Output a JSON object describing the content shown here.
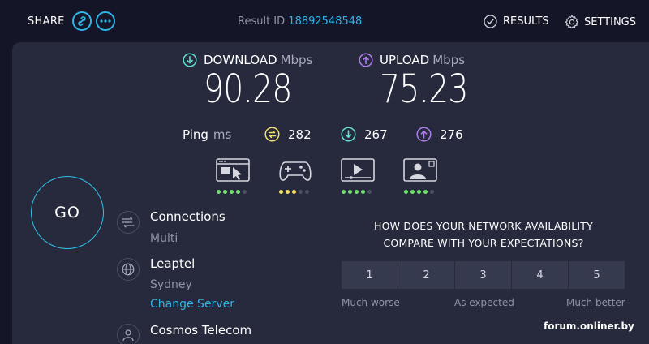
{
  "header": {
    "share_label": "SHARE",
    "result_id_label": "Result ID",
    "result_id_value": "18892548548",
    "results_label": "RESULTS",
    "settings_label": "SETTINGS"
  },
  "download": {
    "label": "DOWNLOAD",
    "unit": "Mbps",
    "value": "90.28"
  },
  "upload": {
    "label": "UPLOAD",
    "unit": "Mbps",
    "value": "75.23"
  },
  "ping": {
    "label": "Ping",
    "unit": "ms",
    "idle": "282",
    "download": "267",
    "upload": "276"
  },
  "usecases": [
    {
      "icon": "web-browsing-icon",
      "rating": 4,
      "color": "#6fe36b"
    },
    {
      "icon": "gaming-icon",
      "rating": 3,
      "color": "#f3e06a"
    },
    {
      "icon": "video-streaming-icon",
      "rating": 4,
      "color": "#6fe36b"
    },
    {
      "icon": "video-call-icon",
      "rating": 4,
      "color": "#6fe36b"
    }
  ],
  "go_label": "GO",
  "connections": {
    "title": "Connections",
    "value": "Multi"
  },
  "server": {
    "name": "Leaptel",
    "location": "Sydney",
    "change_label": "Change Server"
  },
  "isp": {
    "name": "Cosmos Telecom"
  },
  "survey": {
    "question_line1": "HOW DOES YOUR NETWORK AVAILABILITY",
    "question_line2": "COMPARE WITH YOUR EXPECTATIONS?",
    "options": [
      "1",
      "2",
      "3",
      "4",
      "5"
    ],
    "label_low": "Much worse",
    "label_mid": "As expected",
    "label_high": "Much better"
  },
  "watermark": "forum.onliner.by",
  "colors": {
    "accent": "#2fb5e8",
    "download": "#5fe1d3",
    "upload": "#b07ef0",
    "idle": "#f3e06a",
    "background": "#141526",
    "panel": "#262a3c"
  }
}
